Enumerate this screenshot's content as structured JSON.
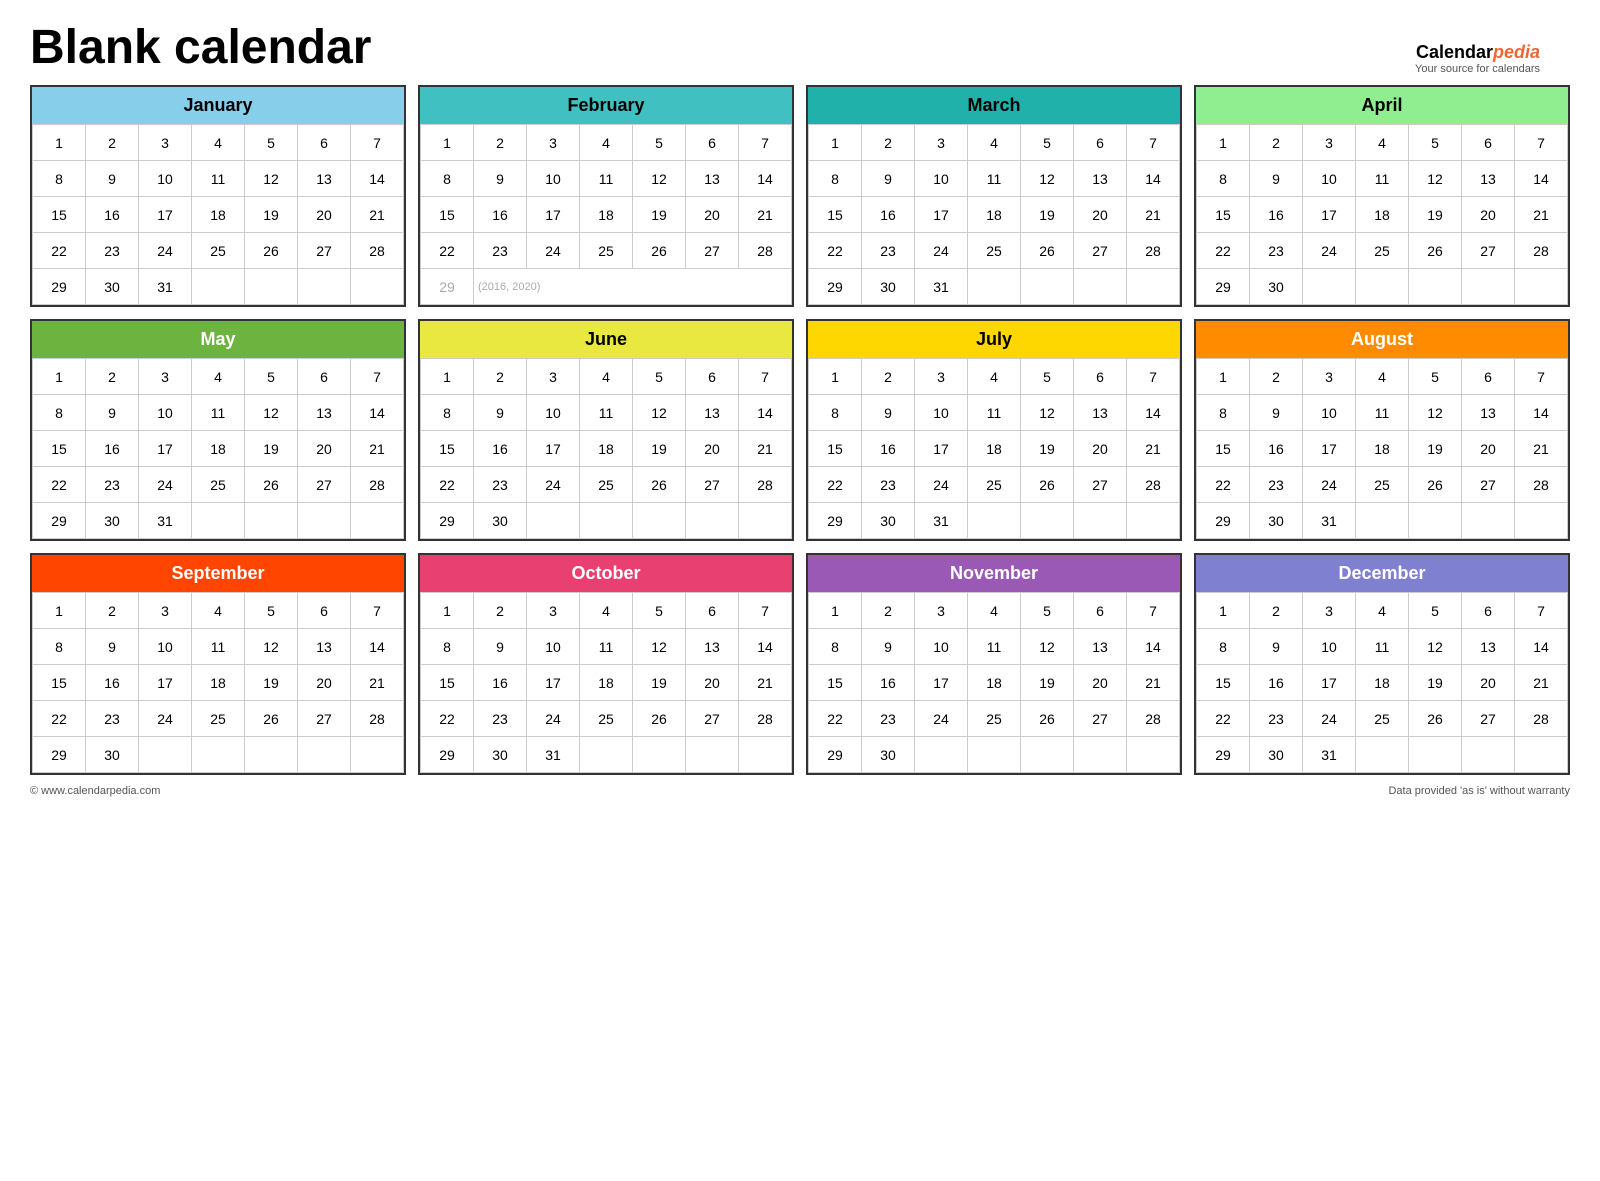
{
  "title": "Blank calendar",
  "logo": {
    "calendar": "Calendar",
    "pedia": "pedia",
    "tagline": "Your source for calendars"
  },
  "footer": {
    "left": "© www.calendarpedia.com",
    "right": "Data provided 'as is' without warranty"
  },
  "months": [
    {
      "name": "January",
      "class": "month-jan",
      "rows": [
        [
          1,
          2,
          3,
          4,
          5,
          6,
          7
        ],
        [
          8,
          9,
          10,
          11,
          12,
          13,
          14
        ],
        [
          15,
          16,
          17,
          18,
          19,
          20,
          21
        ],
        [
          22,
          23,
          24,
          25,
          26,
          27,
          28
        ],
        [
          29,
          30,
          31,
          null,
          null,
          null,
          null
        ]
      ],
      "extraRow": null
    },
    {
      "name": "February",
      "class": "month-feb",
      "rows": [
        [
          1,
          2,
          3,
          4,
          5,
          6,
          7
        ],
        [
          8,
          9,
          10,
          11,
          12,
          13,
          14
        ],
        [
          15,
          16,
          17,
          18,
          19,
          20,
          21
        ],
        [
          22,
          23,
          24,
          25,
          26,
          27,
          28
        ]
      ],
      "extraRow": {
        "day": 29,
        "note": "(2016, 2020)"
      }
    },
    {
      "name": "March",
      "class": "month-mar",
      "rows": [
        [
          1,
          2,
          3,
          4,
          5,
          6,
          7
        ],
        [
          8,
          9,
          10,
          11,
          12,
          13,
          14
        ],
        [
          15,
          16,
          17,
          18,
          19,
          20,
          21
        ],
        [
          22,
          23,
          24,
          25,
          26,
          27,
          28
        ],
        [
          29,
          30,
          31,
          null,
          null,
          null,
          null
        ]
      ],
      "extraRow": null
    },
    {
      "name": "April",
      "class": "month-apr",
      "rows": [
        [
          1,
          2,
          3,
          4,
          5,
          6,
          7
        ],
        [
          8,
          9,
          10,
          11,
          12,
          13,
          14
        ],
        [
          15,
          16,
          17,
          18,
          19,
          20,
          21
        ],
        [
          22,
          23,
          24,
          25,
          26,
          27,
          28
        ],
        [
          29,
          30,
          null,
          null,
          null,
          null,
          null
        ]
      ],
      "extraRow": null
    },
    {
      "name": "May",
      "class": "month-may",
      "rows": [
        [
          1,
          2,
          3,
          4,
          5,
          6,
          7
        ],
        [
          8,
          9,
          10,
          11,
          12,
          13,
          14
        ],
        [
          15,
          16,
          17,
          18,
          19,
          20,
          21
        ],
        [
          22,
          23,
          24,
          25,
          26,
          27,
          28
        ],
        [
          29,
          30,
          31,
          null,
          null,
          null,
          null
        ]
      ],
      "extraRow": null
    },
    {
      "name": "June",
      "class": "month-jun",
      "rows": [
        [
          1,
          2,
          3,
          4,
          5,
          6,
          7
        ],
        [
          8,
          9,
          10,
          11,
          12,
          13,
          14
        ],
        [
          15,
          16,
          17,
          18,
          19,
          20,
          21
        ],
        [
          22,
          23,
          24,
          25,
          26,
          27,
          28
        ],
        [
          29,
          30,
          null,
          null,
          null,
          null,
          null
        ]
      ],
      "extraRow": null
    },
    {
      "name": "July",
      "class": "month-jul",
      "rows": [
        [
          1,
          2,
          3,
          4,
          5,
          6,
          7
        ],
        [
          8,
          9,
          10,
          11,
          12,
          13,
          14
        ],
        [
          15,
          16,
          17,
          18,
          19,
          20,
          21
        ],
        [
          22,
          23,
          24,
          25,
          26,
          27,
          28
        ],
        [
          29,
          30,
          31,
          null,
          null,
          null,
          null
        ]
      ],
      "extraRow": null
    },
    {
      "name": "August",
      "class": "month-aug",
      "rows": [
        [
          1,
          2,
          3,
          4,
          5,
          6,
          7
        ],
        [
          8,
          9,
          10,
          11,
          12,
          13,
          14
        ],
        [
          15,
          16,
          17,
          18,
          19,
          20,
          21
        ],
        [
          22,
          23,
          24,
          25,
          26,
          27,
          28
        ],
        [
          29,
          30,
          31,
          null,
          null,
          null,
          null
        ]
      ],
      "extraRow": null
    },
    {
      "name": "September",
      "class": "month-sep",
      "rows": [
        [
          1,
          2,
          3,
          4,
          5,
          6,
          7
        ],
        [
          8,
          9,
          10,
          11,
          12,
          13,
          14
        ],
        [
          15,
          16,
          17,
          18,
          19,
          20,
          21
        ],
        [
          22,
          23,
          24,
          25,
          26,
          27,
          28
        ],
        [
          29,
          30,
          null,
          null,
          null,
          null,
          null
        ]
      ],
      "extraRow": null
    },
    {
      "name": "October",
      "class": "month-oct",
      "rows": [
        [
          1,
          2,
          3,
          4,
          5,
          6,
          7
        ],
        [
          8,
          9,
          10,
          11,
          12,
          13,
          14
        ],
        [
          15,
          16,
          17,
          18,
          19,
          20,
          21
        ],
        [
          22,
          23,
          24,
          25,
          26,
          27,
          28
        ],
        [
          29,
          30,
          31,
          null,
          null,
          null,
          null
        ]
      ],
      "extraRow": null
    },
    {
      "name": "November",
      "class": "month-nov",
      "rows": [
        [
          1,
          2,
          3,
          4,
          5,
          6,
          7
        ],
        [
          8,
          9,
          10,
          11,
          12,
          13,
          14
        ],
        [
          15,
          16,
          17,
          18,
          19,
          20,
          21
        ],
        [
          22,
          23,
          24,
          25,
          26,
          27,
          28
        ],
        [
          29,
          30,
          null,
          null,
          null,
          null,
          null
        ]
      ],
      "extraRow": null
    },
    {
      "name": "December",
      "class": "month-dec",
      "rows": [
        [
          1,
          2,
          3,
          4,
          5,
          6,
          7
        ],
        [
          8,
          9,
          10,
          11,
          12,
          13,
          14
        ],
        [
          15,
          16,
          17,
          18,
          19,
          20,
          21
        ],
        [
          22,
          23,
          24,
          25,
          26,
          27,
          28
        ],
        [
          29,
          30,
          31,
          null,
          null,
          null,
          null
        ]
      ],
      "extraRow": null
    }
  ]
}
